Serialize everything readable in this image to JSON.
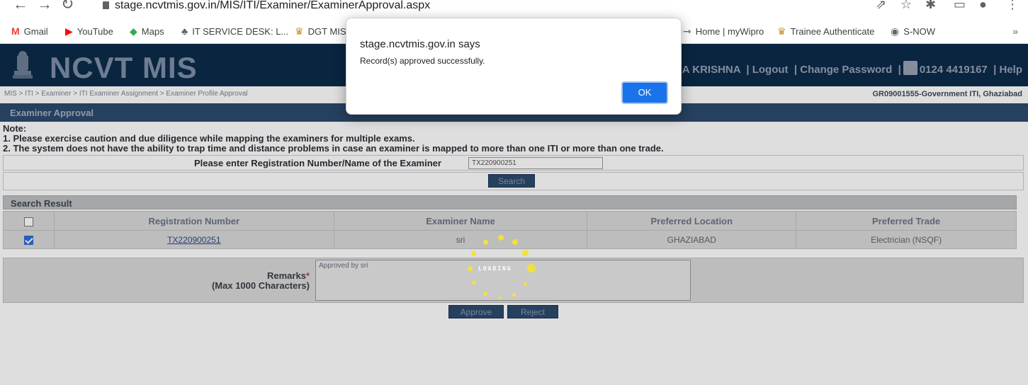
{
  "browser": {
    "url": "stage.ncvtmis.gov.in/MIS/ITI/Examiner/ExaminerApproval.aspx",
    "bookmarks": [
      {
        "label": "Gmail",
        "icon": "gmail-icon",
        "color": "#ea4335"
      },
      {
        "label": "YouTube",
        "icon": "youtube-icon",
        "color": "#ff0000"
      },
      {
        "label": "Maps",
        "icon": "maps-icon",
        "color": "#34a853"
      },
      {
        "label": "IT SERVICE DESK: L...",
        "icon": "service-desk-icon",
        "color": "#5f6368"
      },
      {
        "label": "DGT MIS",
        "icon": "emblem-icon",
        "color": "#c6901c"
      },
      {
        "label": "Home | myWipro",
        "icon": "mywipro-icon",
        "color": "#5f6368"
      },
      {
        "label": "Trainee Authenticate",
        "icon": "emblem-icon",
        "color": "#c6901c"
      },
      {
        "label": "S-NOW",
        "icon": "globe-icon",
        "color": "#5f6368"
      }
    ],
    "more_label": "»"
  },
  "header": {
    "title": "NCVT MIS",
    "user_partial": "HA KRISHNA",
    "logout": "Logout",
    "change_password": "Change Password",
    "phone": "0124 4419167",
    "help": "Help"
  },
  "breadcrumb": "MIS > ITI > Examiner > ITI Examiner Assignment > Examiner Profile Approval",
  "center_code": "GR09001555-Government ITI, Ghaziabad",
  "section_title": "Examiner Approval",
  "note": {
    "heading": "Note:",
    "line1": "1. Please exercise caution and due diligence while mapping the examiners for multiple exams.",
    "line2": "2. The system does not have the ability to trap time and distance problems in case an examiner is mapped to more than one ITI or more than one trade."
  },
  "search": {
    "label": "Please enter Registration Number/Name of the Examiner",
    "value": "TX220900251",
    "button": "Search"
  },
  "results": {
    "title": "Search Result",
    "columns": [
      "Registration Number",
      "Examiner Name",
      "Preferred Location",
      "Preferred Trade"
    ],
    "rows": [
      {
        "registration": "TX220900251",
        "name": "sri",
        "location": "GHAZIABAD",
        "trade": "Electrician (NSQF)",
        "checked": true
      }
    ]
  },
  "remarks": {
    "label": "Remarks",
    "required_mark": "*",
    "hint": "(Max 1000 Characters)",
    "value": "Approved by sri"
  },
  "actions": {
    "approve": "Approve",
    "reject": "Reject"
  },
  "loading": {
    "text": "LOADING"
  },
  "dialog": {
    "title": "stage.ncvtmis.gov.in says",
    "message": "Record(s) approved successfully.",
    "ok": "OK"
  },
  "colors": {
    "header_bg": "#0c2b4a",
    "section_bg": "#2c4a6e",
    "dialog_ok": "#1a73e8",
    "spinner": "#f2e13a"
  }
}
